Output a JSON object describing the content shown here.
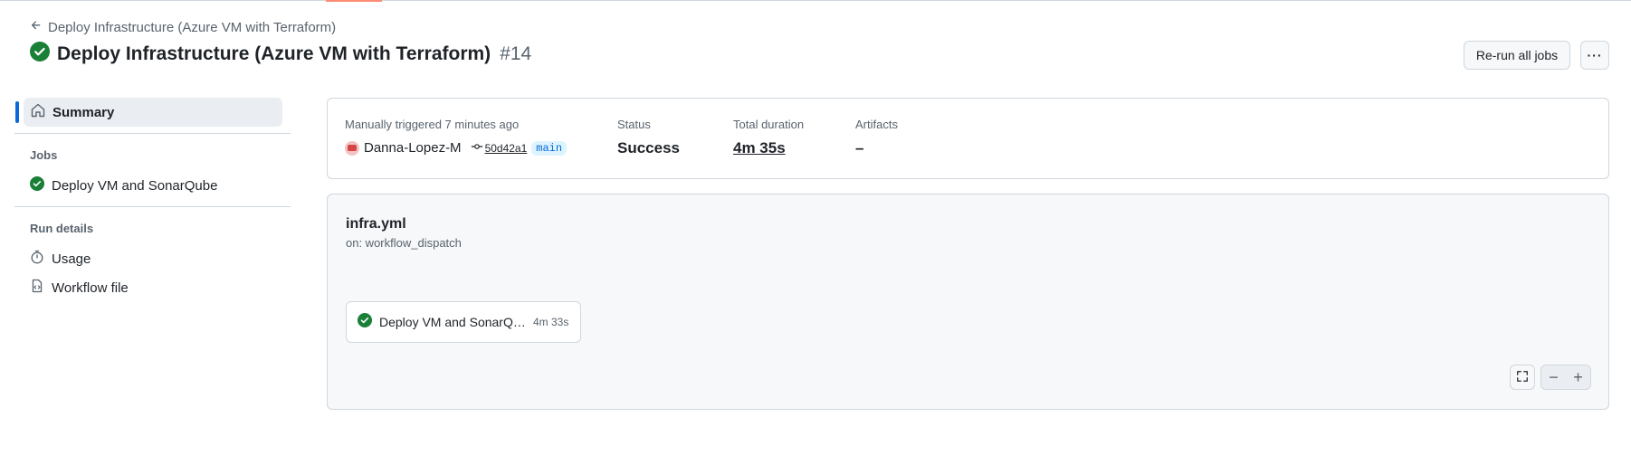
{
  "header": {
    "back_label": "Deploy Infrastructure (Azure VM with Terraform)",
    "title": "Deploy Infrastructure (Azure VM with Terraform)",
    "run_number": "#14",
    "rerun_label": "Re-run all jobs",
    "more_label": "···"
  },
  "sidebar": {
    "summary_label": "Summary",
    "jobs_heading": "Jobs",
    "job_label": "Deploy VM and SonarQube",
    "run_details_heading": "Run details",
    "usage_label": "Usage",
    "workflow_file_label": "Workflow file"
  },
  "summary": {
    "trigger_text": "Manually triggered 7 minutes ago",
    "actor": "Danna-Lopez-M",
    "commit": "50d42a1",
    "branch": "main",
    "status_label": "Status",
    "status_value": "Success",
    "duration_label": "Total duration",
    "duration_value": "4m 35s",
    "artifacts_label": "Artifacts",
    "artifacts_value": "–"
  },
  "graph": {
    "workflow_file": "infra.yml",
    "trigger": "on: workflow_dispatch",
    "job_name": "Deploy VM and SonarQube",
    "job_duration": "4m 33s",
    "zoom_out": "−",
    "zoom_in": "+"
  },
  "colors": {
    "success": "#1a7f37",
    "accent": "#0969da"
  }
}
